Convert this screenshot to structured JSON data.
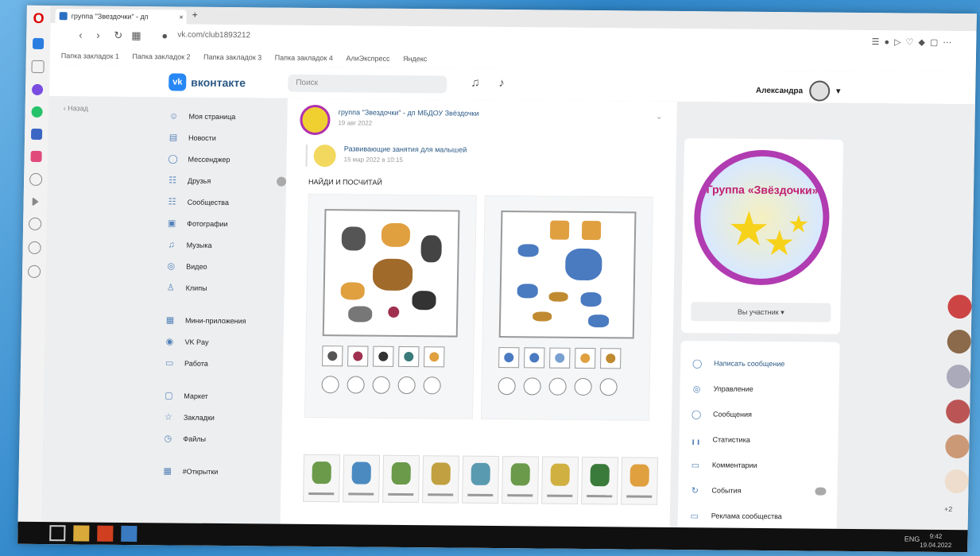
{
  "browser": {
    "tab_title": "группа \"Звездочки\" - дп",
    "tab_close": "×",
    "new_tab": "+",
    "url": "vk.com/club1893212",
    "bookmarks": [
      "Папка закладок 1",
      "Папка закладок 2",
      "Папка закладок 3",
      "Папка закладок 4",
      "АлиЭкспресс",
      "Яндекс"
    ]
  },
  "vk": {
    "logo_text": "вконтакте",
    "search_placeholder": "Поиск",
    "user_name": "Александра",
    "back_label": "Назад",
    "menu": [
      {
        "icon": "☺",
        "label": "Моя страница"
      },
      {
        "icon": "▤",
        "label": "Новости"
      },
      {
        "icon": "◯",
        "label": "Мессенджер"
      },
      {
        "icon": "☷",
        "label": "Друзья",
        "badge": true
      },
      {
        "icon": "☷",
        "label": "Сообщества"
      },
      {
        "icon": "▣",
        "label": "Фотографии"
      },
      {
        "icon": "♫",
        "label": "Музыка"
      },
      {
        "icon": "◎",
        "label": "Видео"
      },
      {
        "icon": "♙",
        "label": "Клипы"
      }
    ],
    "menu2": [
      {
        "icon": "▦",
        "label": "Мини-приложения"
      },
      {
        "icon": "◉",
        "label": "VK Pay"
      },
      {
        "icon": "▭",
        "label": "Работа"
      }
    ],
    "menu3": [
      {
        "icon": "▢",
        "label": "Маркет"
      },
      {
        "icon": "☆",
        "label": "Закладки"
      },
      {
        "icon": "◷",
        "label": "Файлы"
      }
    ],
    "menu4": [
      {
        "icon": "▦",
        "label": "#Открытки"
      }
    ],
    "post": {
      "group_name": "группа \"Звездочки\" - дп МБДОУ Звёздочки",
      "group_date": "19 авг 2022",
      "repost_name": "Развивающие занятия для малышей",
      "repost_date": "15 мар 2022 в 10:15",
      "text": "НАЙДИ И ПОСЧИТАЙ"
    },
    "right": {
      "logo_title": "Группа «Звёздочки»",
      "member_button": "Вы участник ▾",
      "actions": [
        {
          "icon": "◯",
          "label": "Написать сообщение"
        },
        {
          "icon": "◎",
          "label": "Управление"
        },
        {
          "icon": "◯",
          "label": "Сообщения"
        },
        {
          "icon": "╻╻",
          "label": "Статистика"
        },
        {
          "icon": "▭",
          "label": "Комментарии"
        },
        {
          "icon": "↻",
          "label": "События",
          "badge": true
        },
        {
          "icon": "▭",
          "label": "Реклама сообщества"
        }
      ],
      "more_label": "+2"
    }
  },
  "taskbar": {
    "tray": "ENG",
    "clock_time": "9:42",
    "clock_date": "19.04.2022"
  }
}
